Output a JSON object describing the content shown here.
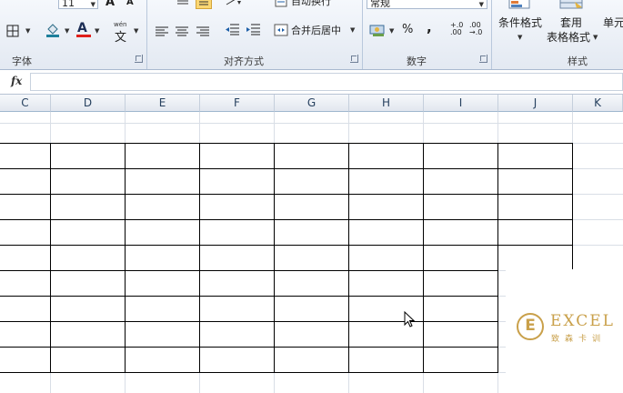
{
  "ribbon": {
    "font_group": {
      "label": "字体",
      "font_size": "11",
      "grow_font": "A",
      "shrink_font": "A",
      "font_color_letter": "A",
      "phonetic_top": "wén",
      "phonetic_bottom": "文"
    },
    "alignment_group": {
      "label": "对齐方式",
      "wrap_text": "自动换行",
      "merge_center": "合并后居中"
    },
    "number_group": {
      "label": "数字",
      "format_value": "常规",
      "percent": "%",
      "comma": ",",
      "increase_decimal": "+.0 .00",
      "decrease_decimal": ".00 →.0"
    },
    "styles_group": {
      "label": "样式",
      "conditional_format": "条件格式",
      "format_table_top": "套用",
      "format_table_bottom": "表格格式",
      "cell_styles": "单元"
    }
  },
  "formula_bar": {
    "fx": "fx",
    "value": ""
  },
  "columns": [
    "C",
    "D",
    "E",
    "F",
    "G",
    "H",
    "I",
    "J",
    "K"
  ],
  "watermark": {
    "letter": "E",
    "brand": "EXCEL",
    "sub": "致森卡训"
  },
  "colors": {
    "ribbon_bg": "#e3e9f2",
    "header_text": "#27415f",
    "gridline": "#d9dee6",
    "border": "#000000",
    "brand_gold": "#c9a04a"
  }
}
